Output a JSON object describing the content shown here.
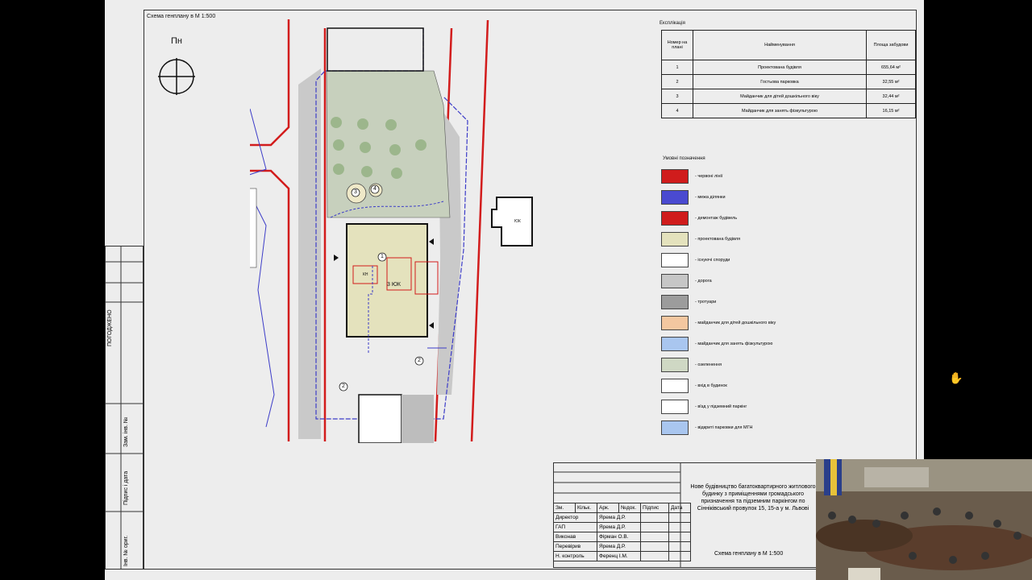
{
  "plan": {
    "title": "Схема генплану в М 1:500",
    "north_label": "Пн"
  },
  "explication": {
    "title": "Експлікація",
    "headers": [
      "Номер на плані",
      "Найменування",
      "Площа забудови"
    ],
    "rows": [
      [
        "1",
        "Проектована будівля",
        "655,64 м²"
      ],
      [
        "2",
        "Гостьова парковка",
        "32,55 м²"
      ],
      [
        "3",
        "Майданчик для дітей дошкільного віку",
        "32,44 м²"
      ],
      [
        "4",
        "Майданчик для занять фізкультурою",
        "16,15 м²"
      ]
    ]
  },
  "legend": {
    "title": "Умовні позначення",
    "items": [
      {
        "label": "- червоні лінії",
        "color": "#d01c1c"
      },
      {
        "label": "- межа ділянки",
        "color": "#4a4ad0"
      },
      {
        "label": "- демонтаж будівель",
        "color": "#d01c1c"
      },
      {
        "label": "- проектована будівля",
        "color": "#e4e2bd"
      },
      {
        "label": "- існуючі споруди",
        "color": "#ffffff"
      },
      {
        "label": "- дорога",
        "color": "#c6c6c6"
      },
      {
        "label": "- тротуари",
        "color": "#9c9c9c"
      },
      {
        "label": "- майданчик для дітей дошкільного віку",
        "color": "#f3c7a0"
      },
      {
        "label": "- майданчик для занять фізкультурою",
        "color": "#a9c6ef"
      },
      {
        "label": "- озеленення",
        "color": "#cfd8c4"
      },
      {
        "label": "- вхід в будинок",
        "color": "#ffffff"
      },
      {
        "label": "- вїзд у підземний паркінг",
        "color": "#ffffff"
      },
      {
        "label": "- відкриті парковки для МГН",
        "color": "#a9c6ef"
      }
    ]
  },
  "site_labels": {
    "building": "3 ЮК",
    "marker_1": "1",
    "marker_2": "2",
    "marker_3": "3",
    "marker_4": "4",
    "kn": "КН",
    "yk": "ЮК"
  },
  "stamp": {
    "approved": "ПОГОДЖЕНО",
    "inv_orig": "Інв. № ориг.",
    "sign_date": "Підпис і дата",
    "replace_inv": "Зам. інв. №"
  },
  "title_block": {
    "project": "Нове будівництво багатоквартирного житлового будинку з приміщеннями громадського призначення та підземним паркінгом по Сінніківський провулок 15, 15-а у м. Львові",
    "sheet": "Схема генплану в М 1:500",
    "head": [
      "Зм.",
      "Кільк.",
      "Арк.",
      "№док.",
      "Підпис",
      "Дата"
    ],
    "people": [
      [
        "Директор",
        "Ярема Д.Р."
      ],
      [
        "ГАП",
        "Ярема Д.Р."
      ],
      [
        "Виконав",
        "Фірман О.В."
      ],
      [
        "Перевірив",
        "Ярема Д.Р."
      ],
      [
        "Н. контроль",
        "Ференц І.М."
      ]
    ]
  }
}
